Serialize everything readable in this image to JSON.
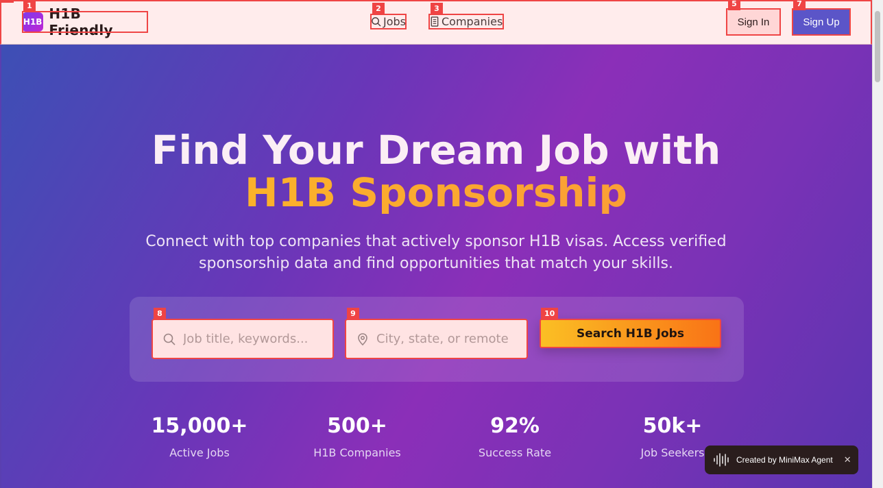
{
  "header": {
    "logo_badge": "H1B",
    "brand": "H1B Friendly",
    "nav": [
      {
        "label": "Jobs",
        "icon": "search-icon"
      },
      {
        "label": "Companies",
        "icon": "document-icon"
      }
    ],
    "sign_in": "Sign In",
    "sign_up": "Sign Up"
  },
  "hero": {
    "title_line1": "Find Your Dream Job with",
    "title_line2": "H1B Sponsorship",
    "subtitle": "Connect with top companies that actively sponsor H1B visas. Access verified sponsorship data and find opportunities that match your skills."
  },
  "search": {
    "keyword_placeholder": "Job title, keywords...",
    "location_placeholder": "City, state, or remote",
    "button": "Search H1B Jobs"
  },
  "stats": [
    {
      "value": "15,000+",
      "label": "Active Jobs"
    },
    {
      "value": "500+",
      "label": "H1B Companies"
    },
    {
      "value": "92%",
      "label": "Success Rate"
    },
    {
      "value": "50k+",
      "label": "Job Seekers"
    }
  ],
  "toast": {
    "label": "Created by MiniMax Agent",
    "close": "✕"
  },
  "markers": [
    "1",
    "2",
    "3",
    "5",
    "7",
    "8",
    "9",
    "10"
  ],
  "colors": {
    "accent_orange": "#fbbf24",
    "accent_red_outline": "#ef4444",
    "signup_bg": "#5b55c8"
  }
}
